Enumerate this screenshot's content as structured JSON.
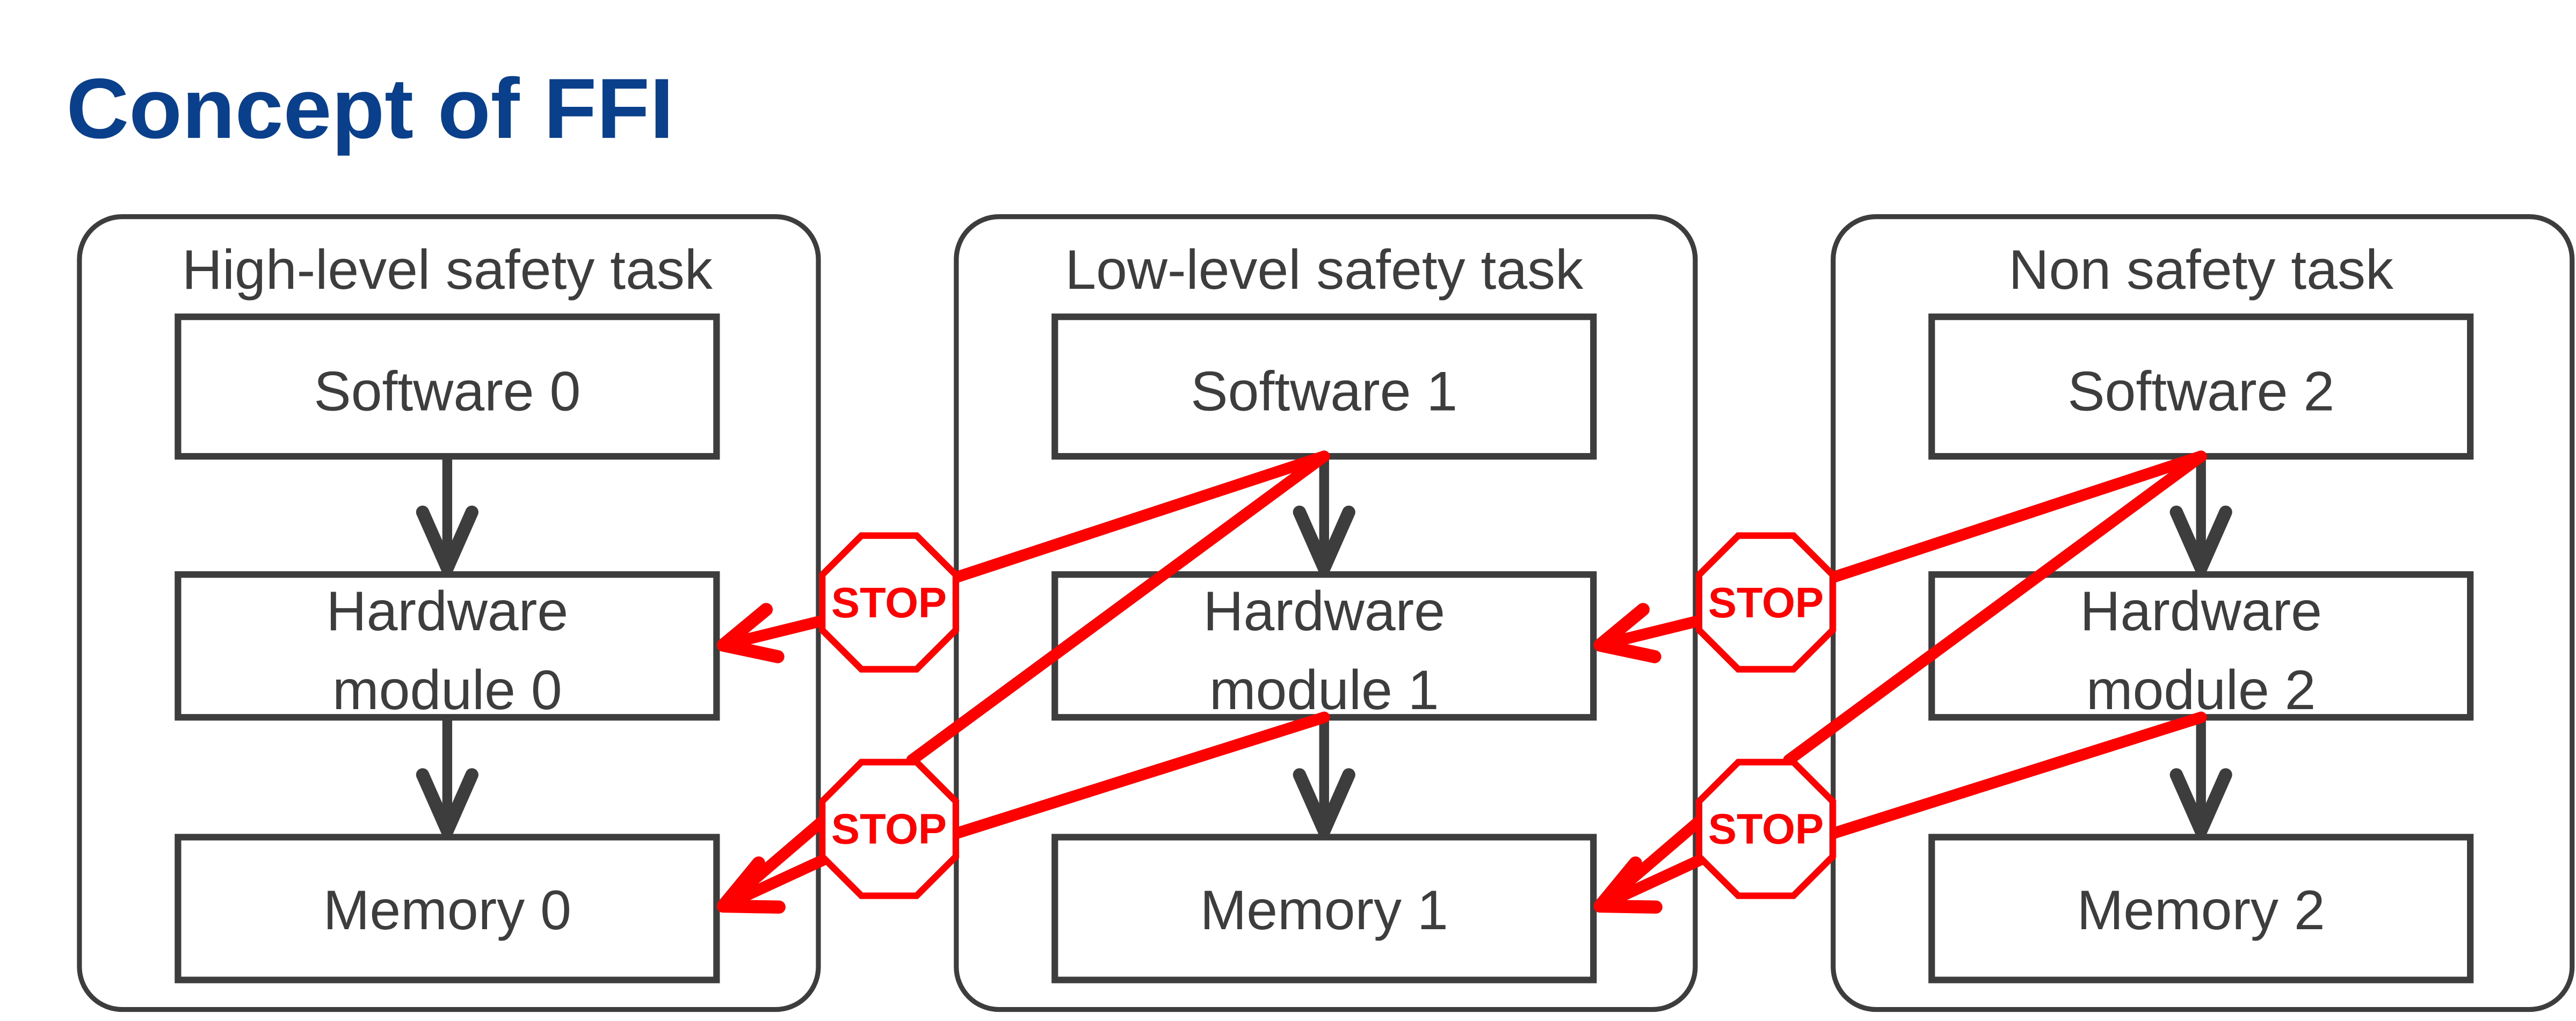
{
  "title": "Concept of FFI",
  "colors": {
    "title": "#0a3f8c",
    "box": "#3d3d3d",
    "stop": "#ff0000",
    "arrow": "#ff0000"
  },
  "stop_label": "STOP",
  "panels": [
    {
      "title": "High-level safety task",
      "software": "Software 0",
      "hardware": [
        "Hardware",
        "module 0"
      ],
      "memory": "Memory 0"
    },
    {
      "title": "Low-level safety task",
      "software": "Software 1",
      "hardware": [
        "Hardware",
        "module 1"
      ],
      "memory": "Memory 1"
    },
    {
      "title": "Non safety task",
      "software": "Software 2",
      "hardware": [
        "Hardware",
        "module 2"
      ],
      "memory": "Memory 2"
    }
  ]
}
